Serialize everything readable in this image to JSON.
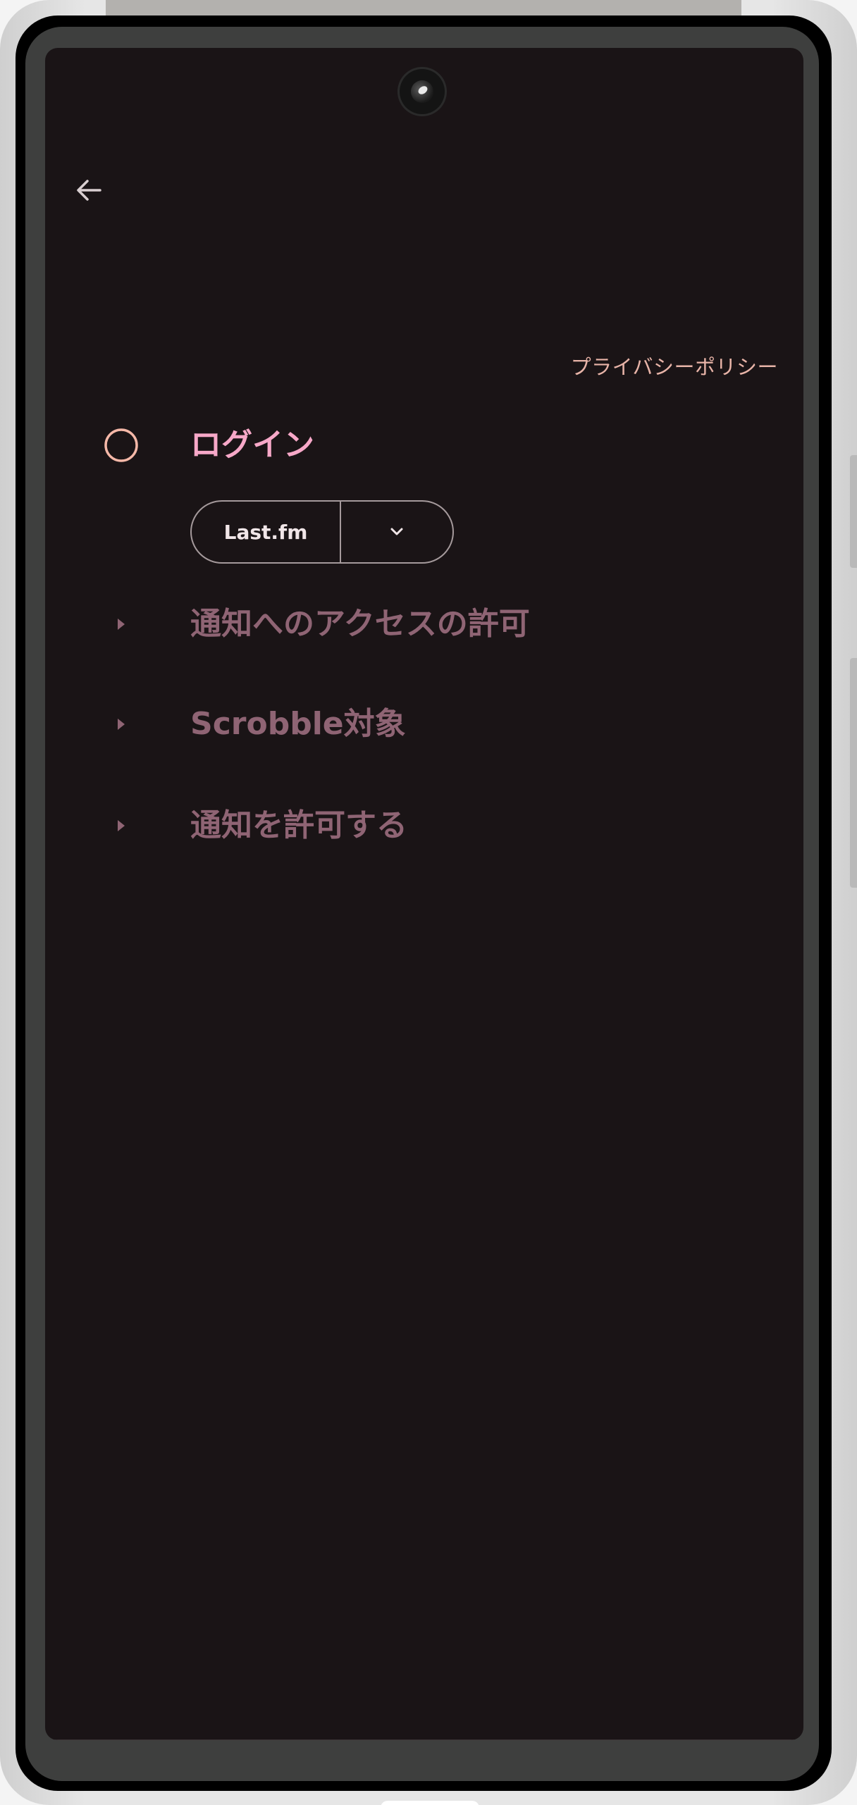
{
  "toolbar": {
    "back_icon": "arrow-back-icon"
  },
  "privacy_link": "プライバシーポリシー",
  "steps": [
    {
      "label": "ログイン",
      "state": "active",
      "icon": "radio-circle-icon"
    },
    {
      "label": "通知へのアクセスの許可",
      "state": "inactive",
      "icon": "caret-right-icon"
    },
    {
      "label": "Scrobble対象",
      "state": "inactive",
      "icon": "caret-right-icon"
    },
    {
      "label": "通知を許可する",
      "state": "inactive",
      "icon": "caret-right-icon"
    }
  ],
  "login_button": {
    "service_label": "Last.fm",
    "dropdown_icon": "chevron-down-icon"
  },
  "colors": {
    "screen_background": "#1a1416",
    "active_step": "#f7a8c8",
    "inactive_step": "#8f6474",
    "privacy_link": "#e8b4a8",
    "outline": "#a59a9c"
  }
}
